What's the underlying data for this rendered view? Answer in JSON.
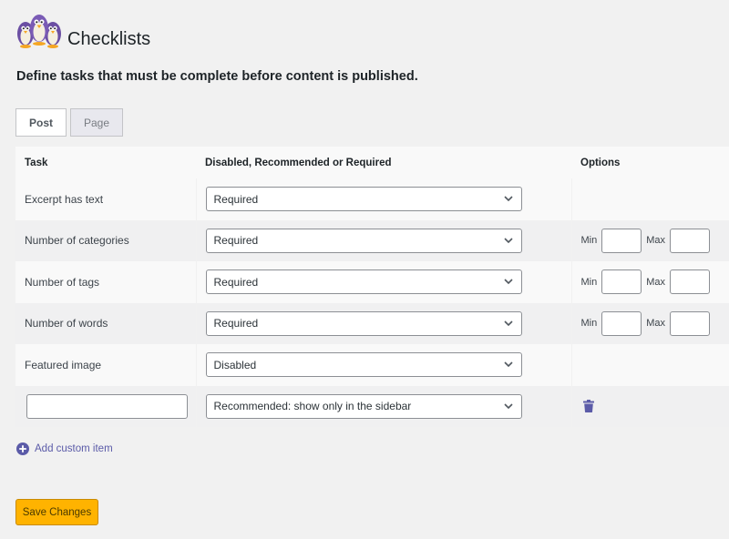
{
  "header": {
    "title": "Checklists",
    "description": "Define tasks that must be complete before content is published."
  },
  "tabs": [
    {
      "label": "Post",
      "active": true
    },
    {
      "label": "Page",
      "active": false
    }
  ],
  "table": {
    "columns": [
      "Task",
      "Disabled, Recommended or Required",
      "Options"
    ],
    "rows": [
      {
        "task": "Excerpt has text",
        "status": "Required"
      },
      {
        "task": "Number of categories",
        "status": "Required",
        "min_label": "Min",
        "max_label": "Max"
      },
      {
        "task": "Number of tags",
        "status": "Required",
        "min_label": "Min",
        "max_label": "Max"
      },
      {
        "task": "Number of words",
        "status": "Required",
        "min_label": "Min",
        "max_label": "Max"
      },
      {
        "task": "Featured image",
        "status": "Disabled"
      },
      {
        "task": "",
        "status": "Recommended: show only in the sidebar"
      }
    ]
  },
  "actions": {
    "add_custom_item": "Add custom item",
    "save_changes": "Save Changes"
  },
  "colors": {
    "accent": "#5b5ba8",
    "save_button": "#ffb300",
    "background": "#f1f1f1"
  },
  "icons": {
    "logo": "penguins-logo-icon",
    "dropdown": "chevron-down-icon",
    "delete": "trash-icon",
    "add": "plus-circle-icon"
  }
}
